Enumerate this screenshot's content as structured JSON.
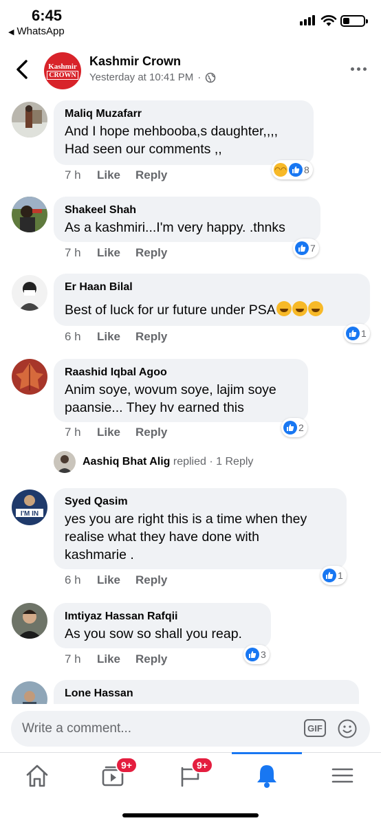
{
  "status_bar": {
    "time": "6:45",
    "back_app": "WhatsApp"
  },
  "header": {
    "page_name": "Kashmir Crown",
    "logo_line1": "Kashmir",
    "logo_line2": "CROWN",
    "timestamp": "Yesterday at 10:41 PM",
    "separator": "·"
  },
  "comments": [
    {
      "author": "Maliq Muzafarr",
      "text": "And I hope mehbooba,s daughter,,,,\nHad seen our comments ,,",
      "time": "7 h",
      "like": "Like",
      "reply": "Reply",
      "reaction_count": "8",
      "reactions": [
        "haha",
        "like"
      ]
    },
    {
      "author": "Shakeel Shah",
      "text": "As a kashmiri...I'm very happy. .thnks",
      "time": "7 h",
      "like": "Like",
      "reply": "Reply",
      "reaction_count": "7",
      "reactions": [
        "like"
      ]
    },
    {
      "author": "Er Haan Bilal",
      "text": "Best of luck for ur future under PSA",
      "time": "6 h",
      "like": "Like",
      "reply": "Reply",
      "reaction_count": "1",
      "reactions": [
        "like"
      ]
    },
    {
      "author": "Raashid Iqbal Agoo",
      "text": "Anim soye, wovum soye, lajim soye\npaansie...  They hv earned this",
      "time": "7 h",
      "like": "Like",
      "reply": "Reply",
      "reaction_count": "2",
      "reactions": [
        "like"
      ]
    },
    {
      "author": "Syed Qasim",
      "text": "yes you are right this is a time when they\nrealise what they have done with\nkashmarie .",
      "time": "6 h",
      "like": "Like",
      "reply": "Reply",
      "reaction_count": "1",
      "reactions": [
        "like"
      ]
    },
    {
      "author": "Imtiyaz Hassan Rafqii",
      "text": "As you sow so shall you reap.",
      "time": "7 h",
      "like": "Like",
      "reply": "Reply",
      "reaction_count": "3",
      "reactions": [
        "like"
      ]
    },
    {
      "author": "Lone Hassan",
      "text": "",
      "time": "",
      "like": "",
      "reply": "",
      "reaction_count": "",
      "reactions": []
    }
  ],
  "reply_summary": {
    "name": "Aashiq Bhat Alig",
    "verb": "replied",
    "separator": "·",
    "count": "1 Reply"
  },
  "syed_avatar_text": "I'M IN",
  "compose": {
    "placeholder": "Write a comment...",
    "gif_label": "GIF"
  },
  "tabbar": {
    "tabs": [
      {
        "icon": "home-icon"
      },
      {
        "icon": "watch-icon",
        "badge": "9+"
      },
      {
        "icon": "pages-flag-icon",
        "badge": "9+"
      },
      {
        "icon": "bell-icon",
        "active": true
      },
      {
        "icon": "menu-icon"
      }
    ]
  },
  "colors": {
    "accent": "#1877f2",
    "bubble": "#f0f2f5",
    "badge": "#e41e3f",
    "secondary_text": "#65676b",
    "logo": "#d8232a"
  }
}
